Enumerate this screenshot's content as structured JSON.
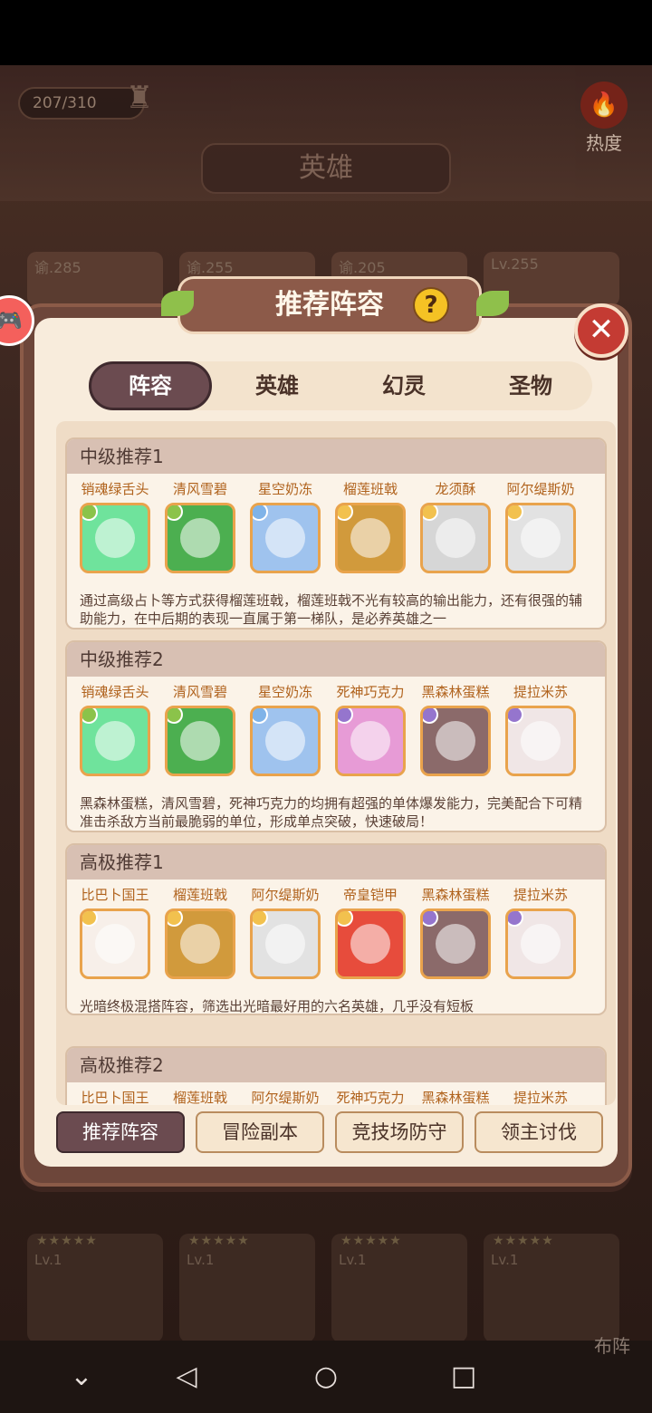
{
  "top": {
    "capacity": "207/310",
    "heat_label": "热度",
    "screen_title": "英雄"
  },
  "bg_cards": [
    "谕.285",
    "谕.255",
    "谕.205",
    "Lv.255"
  ],
  "bottom_cards": [
    "Lv.1",
    "Lv.1",
    "Lv.1",
    "Lv.1"
  ],
  "modal": {
    "title": "推荐阵容",
    "help": "?",
    "close": "✕",
    "tabs": [
      "阵容",
      "英雄",
      "幻灵",
      "圣物"
    ],
    "panels": [
      {
        "title": "中级推荐1",
        "heroes": [
          {
            "name": "销魂绿舌头",
            "color": "#6fe39c",
            "badge": "#8bc34a"
          },
          {
            "name": "清风雪碧",
            "color": "#4caf50",
            "badge": "#8bc34a"
          },
          {
            "name": "星空奶冻",
            "color": "#9fc3ee",
            "badge": "#7fb3e8"
          },
          {
            "name": "榴莲班戟",
            "color": "#d19a3c",
            "badge": "#f2c14e"
          },
          {
            "name": "龙须酥",
            "color": "#d6d6d6",
            "badge": "#f2c14e"
          },
          {
            "name": "阿尔缇斯奶",
            "color": "#e2e2e2",
            "badge": "#f2c14e"
          }
        ],
        "desc": "通过高级占卜等方式获得榴莲班戟，榴莲班戟不光有较高的输出能力，还有很强的辅助能力，在中后期的表现一直属于第一梯队，是必养英雄之一"
      },
      {
        "title": "中级推荐2",
        "heroes": [
          {
            "name": "销魂绿舌头",
            "color": "#6fe39c",
            "badge": "#8bc34a"
          },
          {
            "name": "清风雪碧",
            "color": "#4caf50",
            "badge": "#8bc34a"
          },
          {
            "name": "星空奶冻",
            "color": "#9fc3ee",
            "badge": "#7fb3e8"
          },
          {
            "name": "死神巧克力",
            "color": "#e79bd6",
            "badge": "#9575cd"
          },
          {
            "name": "黑森林蛋糕",
            "color": "#8b6a6a",
            "badge": "#9575cd"
          },
          {
            "name": "提拉米苏",
            "color": "#f0e6e6",
            "badge": "#9575cd"
          }
        ],
        "desc": "黑森林蛋糕，清风雪碧，死神巧克力的均拥有超强的单体爆发能力，完美配合下可精准击杀敌方当前最脆弱的单位，形成单点突破，快速破局！"
      },
      {
        "title": "高极推荐1",
        "heroes": [
          {
            "name": "比巴卜国王",
            "color": "#f7efe9",
            "badge": "#f2c14e"
          },
          {
            "name": "榴莲班戟",
            "color": "#d19a3c",
            "badge": "#f2c14e"
          },
          {
            "name": "阿尔缇斯奶",
            "color": "#e2e2e2",
            "badge": "#f2c14e"
          },
          {
            "name": "帝皇铠甲",
            "color": "#e74c3c",
            "badge": "#f2c14e"
          },
          {
            "name": "黑森林蛋糕",
            "color": "#8b6a6a",
            "badge": "#9575cd"
          },
          {
            "name": "提拉米苏",
            "color": "#f0e6e6",
            "badge": "#9575cd"
          }
        ],
        "desc": "光暗终极混搭阵容，筛选出光暗最好用的六名英雄，几乎没有短板"
      },
      {
        "title": "高极推荐2",
        "heroes": [
          {
            "name": "比巴卜国王",
            "color": "#f7efe9",
            "badge": "#f2c14e"
          },
          {
            "name": "榴莲班戟",
            "color": "#d19a3c",
            "badge": "#f2c14e"
          },
          {
            "name": "阿尔缇斯奶",
            "color": "#e2e2e2",
            "badge": "#f2c14e"
          },
          {
            "name": "死神巧克力",
            "color": "#e79bd6",
            "badge": "#9575cd"
          },
          {
            "name": "黑森林蛋糕",
            "color": "#8b6a6a",
            "badge": "#9575cd"
          },
          {
            "name": "提拉米苏",
            "color": "#f0e6e6",
            "badge": "#9575cd"
          }
        ],
        "desc": ""
      }
    ],
    "bottom_tabs": [
      "推荐阵容",
      "冒险副本",
      "竞技场防守",
      "领主讨伐"
    ]
  },
  "formation_label": "布阵",
  "nav": {
    "back": "◁",
    "home": "○",
    "recent": "□",
    "down": "⌄"
  }
}
